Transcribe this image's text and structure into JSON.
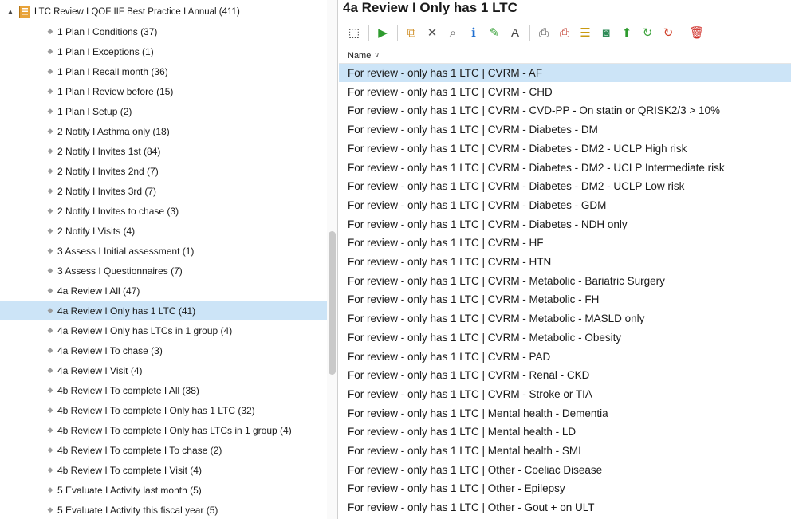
{
  "tree": {
    "root": {
      "label": "LTC Review I QOF IIF Best Practice I Annual (411)",
      "expanded": true
    },
    "items": [
      {
        "label": "1 Plan I Conditions (37)",
        "selected": false
      },
      {
        "label": "1 Plan I Exceptions (1)",
        "selected": false
      },
      {
        "label": "1 Plan I Recall month (36)",
        "selected": false
      },
      {
        "label": "1 Plan I Review before (15)",
        "selected": false
      },
      {
        "label": "1 Plan I Setup (2)",
        "selected": false
      },
      {
        "label": "2 Notify I Asthma only (18)",
        "selected": false
      },
      {
        "label": "2 Notify I Invites 1st (84)",
        "selected": false
      },
      {
        "label": "2 Notify I Invites 2nd (7)",
        "selected": false
      },
      {
        "label": "2 Notify I Invites 3rd (7)",
        "selected": false
      },
      {
        "label": "2 Notify I Invites to chase (3)",
        "selected": false
      },
      {
        "label": "2 Notify I Visits (4)",
        "selected": false
      },
      {
        "label": "3 Assess I Initial assessment (1)",
        "selected": false
      },
      {
        "label": "3 Assess I Questionnaires (7)",
        "selected": false
      },
      {
        "label": "4a Review I All (47)",
        "selected": false
      },
      {
        "label": "4a Review I Only has 1 LTC (41)",
        "selected": true
      },
      {
        "label": "4a Review I Only has LTCs in 1 group (4)",
        "selected": false
      },
      {
        "label": "4a Review I To chase (3)",
        "selected": false
      },
      {
        "label": "4a Review I Visit (4)",
        "selected": false
      },
      {
        "label": "4b Review I To complete I All (38)",
        "selected": false
      },
      {
        "label": "4b Review I To complete I Only has 1 LTC (32)",
        "selected": false
      },
      {
        "label": "4b Review I To complete I Only has LTCs in 1 group (4)",
        "selected": false
      },
      {
        "label": "4b Review I To complete I To chase (2)",
        "selected": false
      },
      {
        "label": "4b Review I To complete I Visit (4)",
        "selected": false
      },
      {
        "label": "5 Evaluate I Activity last month (5)",
        "selected": false
      },
      {
        "label": "5 Evaluate I Activity this fiscal year (5)",
        "selected": false
      }
    ]
  },
  "view": {
    "title": "4a Review I Only has 1 LTC",
    "column_header": "Name"
  },
  "toolbar": {
    "buttons": [
      {
        "name": "select-icon",
        "glyph": "⬚",
        "color": "#333333"
      },
      {
        "sep": true
      },
      {
        "name": "run-icon",
        "glyph": "▶",
        "color": "#2e9b2e"
      },
      {
        "sep": true
      },
      {
        "name": "copy-icon",
        "glyph": "⧉",
        "color": "#d0902a"
      },
      {
        "name": "delete-x-icon",
        "glyph": "✕",
        "color": "#555555"
      },
      {
        "name": "search-icon",
        "glyph": "⌕",
        "color": "#555555"
      },
      {
        "name": "info-icon",
        "glyph": "ℹ",
        "color": "#1f6fd1"
      },
      {
        "name": "edit-pen-icon",
        "glyph": "✎",
        "color": "#3ca33c"
      },
      {
        "name": "rename-text-icon",
        "glyph": "A",
        "color": "#444444"
      },
      {
        "sep": true
      },
      {
        "name": "print-icon",
        "glyph": "⎙",
        "color": "#555555"
      },
      {
        "name": "print-red-icon",
        "glyph": "⎙",
        "color": "#c0392b"
      },
      {
        "name": "list-report-icon",
        "glyph": "☰",
        "color": "#c99a10"
      },
      {
        "name": "chart-icon",
        "glyph": "◙",
        "color": "#2e8b57"
      },
      {
        "name": "upload-arrow-icon",
        "glyph": "⬆",
        "color": "#2e9b2e"
      },
      {
        "name": "refresh-icon",
        "glyph": "↻",
        "color": "#3ca33c"
      },
      {
        "name": "refresh-red-icon",
        "glyph": "↻",
        "color": "#d0402a"
      },
      {
        "sep": true
      },
      {
        "name": "trash-icon",
        "glyph": "🗑",
        "color": "#d0302a"
      }
    ]
  },
  "list": {
    "rows": [
      {
        "label": "For review - only has 1 LTC | CVRM - AF",
        "selected": true
      },
      {
        "label": "For review - only has 1 LTC | CVRM - CHD",
        "selected": false
      },
      {
        "label": "For review - only has 1 LTC | CVRM - CVD-PP - On statin or QRISK2/3 > 10%",
        "selected": false
      },
      {
        "label": "For review - only has 1 LTC | CVRM - Diabetes - DM",
        "selected": false
      },
      {
        "label": "For review - only has 1 LTC | CVRM - Diabetes - DM2 - UCLP High risk",
        "selected": false
      },
      {
        "label": "For review - only has 1 LTC | CVRM - Diabetes - DM2 - UCLP Intermediate risk",
        "selected": false
      },
      {
        "label": "For review - only has 1 LTC | CVRM - Diabetes - DM2 - UCLP Low risk",
        "selected": false
      },
      {
        "label": "For review - only has 1 LTC | CVRM - Diabetes - GDM",
        "selected": false
      },
      {
        "label": "For review - only has 1 LTC | CVRM - Diabetes - NDH only",
        "selected": false
      },
      {
        "label": "For review - only has 1 LTC | CVRM - HF",
        "selected": false
      },
      {
        "label": "For review - only has 1 LTC | CVRM - HTN",
        "selected": false
      },
      {
        "label": "For review - only has 1 LTC | CVRM - Metabolic - Bariatric Surgery",
        "selected": false
      },
      {
        "label": "For review - only has 1 LTC | CVRM - Metabolic - FH",
        "selected": false
      },
      {
        "label": "For review - only has 1 LTC | CVRM - Metabolic - MASLD only",
        "selected": false
      },
      {
        "label": "For review - only has 1 LTC | CVRM - Metabolic - Obesity",
        "selected": false
      },
      {
        "label": "For review - only has 1 LTC | CVRM - PAD",
        "selected": false
      },
      {
        "label": "For review - only has 1 LTC | CVRM - Renal - CKD",
        "selected": false
      },
      {
        "label": "For review - only has 1 LTC | CVRM - Stroke or TIA",
        "selected": false
      },
      {
        "label": "For review - only has 1 LTC | Mental health - Dementia",
        "selected": false
      },
      {
        "label": "For review - only has 1 LTC | Mental health - LD",
        "selected": false
      },
      {
        "label": "For review - only has 1 LTC | Mental health - SMI",
        "selected": false
      },
      {
        "label": "For review - only has 1 LTC | Other - Coeliac Disease",
        "selected": false
      },
      {
        "label": "For review - only has 1 LTC | Other - Epilepsy",
        "selected": false
      },
      {
        "label": "For review - only has 1 LTC | Other - Gout + on ULT",
        "selected": false
      }
    ]
  },
  "colors": {
    "selection": "#cce4f7",
    "folder": "#e8a33a"
  }
}
